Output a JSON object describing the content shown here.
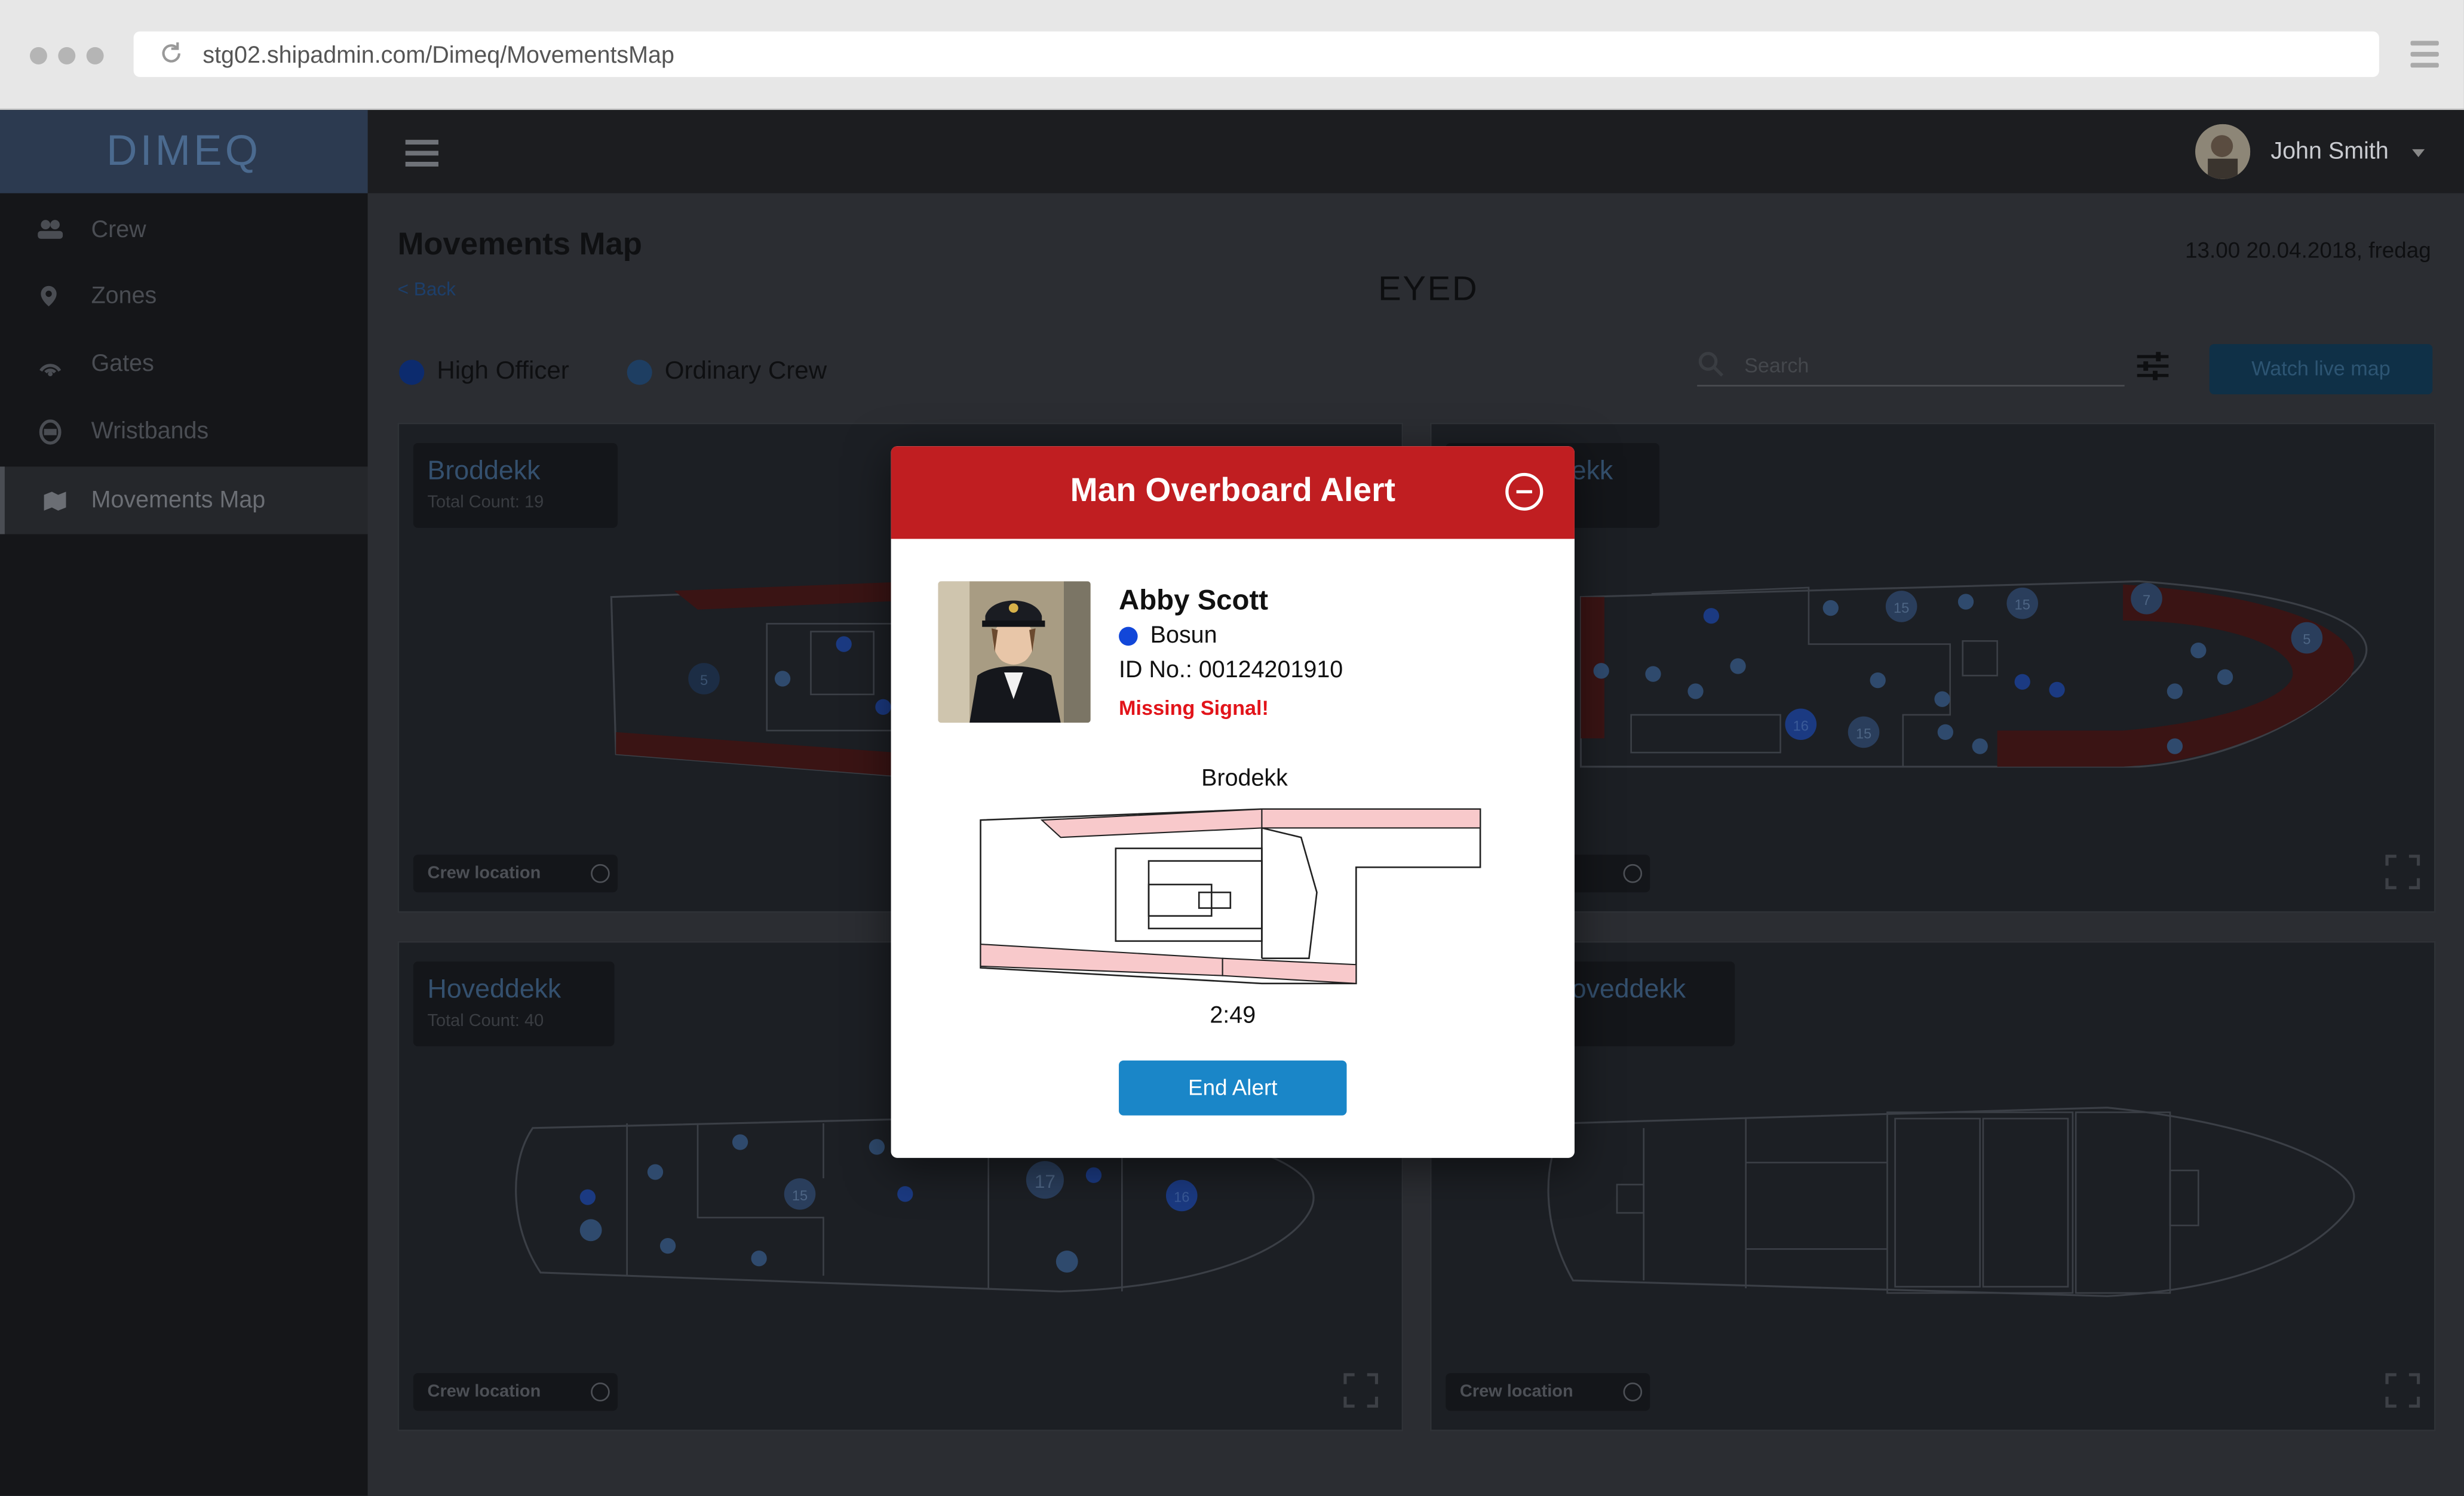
{
  "browser": {
    "url": "stg02.shipadmin.com/Dimeq/MovementsMap"
  },
  "app": {
    "logo": "DIMEQ",
    "user_name": "John Smith"
  },
  "sidebar": {
    "items": [
      {
        "label": "Crew",
        "icon": "crew-icon"
      },
      {
        "label": "Zones",
        "icon": "pin-icon"
      },
      {
        "label": "Gates",
        "icon": "gate-signal-icon"
      },
      {
        "label": "Wristbands",
        "icon": "wristband-icon"
      },
      {
        "label": "Movements Map",
        "icon": "map-icon",
        "active": true
      }
    ]
  },
  "main": {
    "title": "Movements Map",
    "back": "< Back",
    "brand": "EYED",
    "datetime": "13.00 20.04.2018, fredag",
    "legend": [
      {
        "label": "High Officer",
        "color": "#1247d9"
      },
      {
        "label": "Ordinary Crew",
        "color": "#4a8fd6"
      }
    ],
    "search_placeholder": "Search",
    "watch_live": "Watch live map",
    "panels": [
      {
        "name": "Broddekk",
        "count": "Total Count: 19",
        "crew_location": "Crew location"
      },
      {
        "name": "ekk",
        "count": "",
        "crew_location": ""
      },
      {
        "name": "Hoveddekk",
        "count": "Total Count: 40",
        "crew_location": "Crew location"
      },
      {
        "name": "oveddekk",
        "count": "",
        "crew_location": "Crew location"
      }
    ],
    "map_badges": [
      "5",
      "15",
      "15",
      "7",
      "5",
      "16",
      "15",
      "15",
      "17",
      "16"
    ]
  },
  "modal": {
    "title": "Man Overboard Alert",
    "person_name": "Abby Scott",
    "rank": "Bosun",
    "id_no": "ID No.: 00124201910",
    "status": "Missing Signal!",
    "deck": "Brodekk",
    "timer": "2:49",
    "end_button": "End Alert",
    "colors": {
      "header": "#c01e21",
      "button": "#1a86c8",
      "alert_text": "#e2141a",
      "zone_highlight": "#f8c9cb"
    }
  }
}
